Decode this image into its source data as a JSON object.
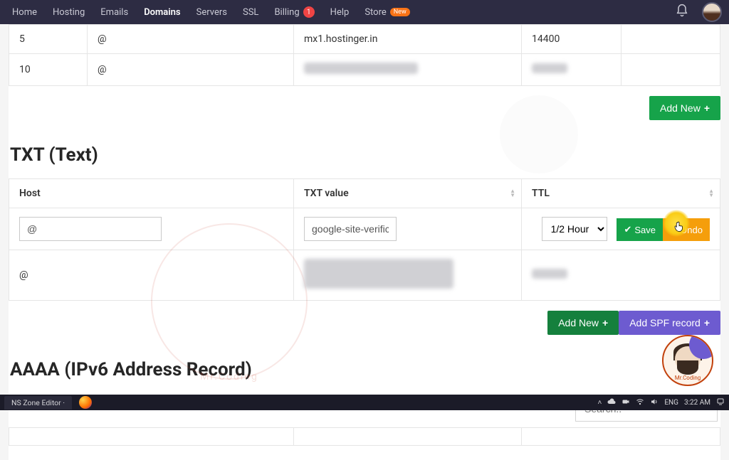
{
  "nav": {
    "items": [
      {
        "label": "Home"
      },
      {
        "label": "Hosting"
      },
      {
        "label": "Emails"
      },
      {
        "label": "Domains",
        "active": true
      },
      {
        "label": "Servers"
      },
      {
        "label": "SSL"
      },
      {
        "label": "Billing",
        "badge": "1"
      },
      {
        "label": "Help"
      },
      {
        "label": "Store",
        "new": "New"
      }
    ]
  },
  "mx_partial": {
    "rows": [
      {
        "priority": "5",
        "host": "@",
        "points": "mx1.hostinger.in",
        "ttl": "14400"
      },
      {
        "priority": "10",
        "host": "@",
        "points": "",
        "ttl": ""
      }
    ],
    "add_new_label": "Add New"
  },
  "txt": {
    "title": "TXT (Text)",
    "headers": {
      "host": "Host",
      "value": "TXT value",
      "ttl": "TTL"
    },
    "edit_row": {
      "host": "@",
      "value": "google-site-verifica",
      "ttl": "1/2 Hour",
      "save_label": "Save",
      "undo_label": "Undo"
    },
    "existing_host": "@",
    "add_new_label": "Add New",
    "add_spf_label": "Add SPF record"
  },
  "aaaa": {
    "title": "AAAA (IPv6 Address Record)",
    "search_placeholder": "Search.."
  },
  "watermark": {
    "label": "Mr.Coding"
  },
  "taskbar": {
    "tab": "NS Zone Editor ·",
    "lang": "ENG",
    "time": "3:22 AM"
  }
}
